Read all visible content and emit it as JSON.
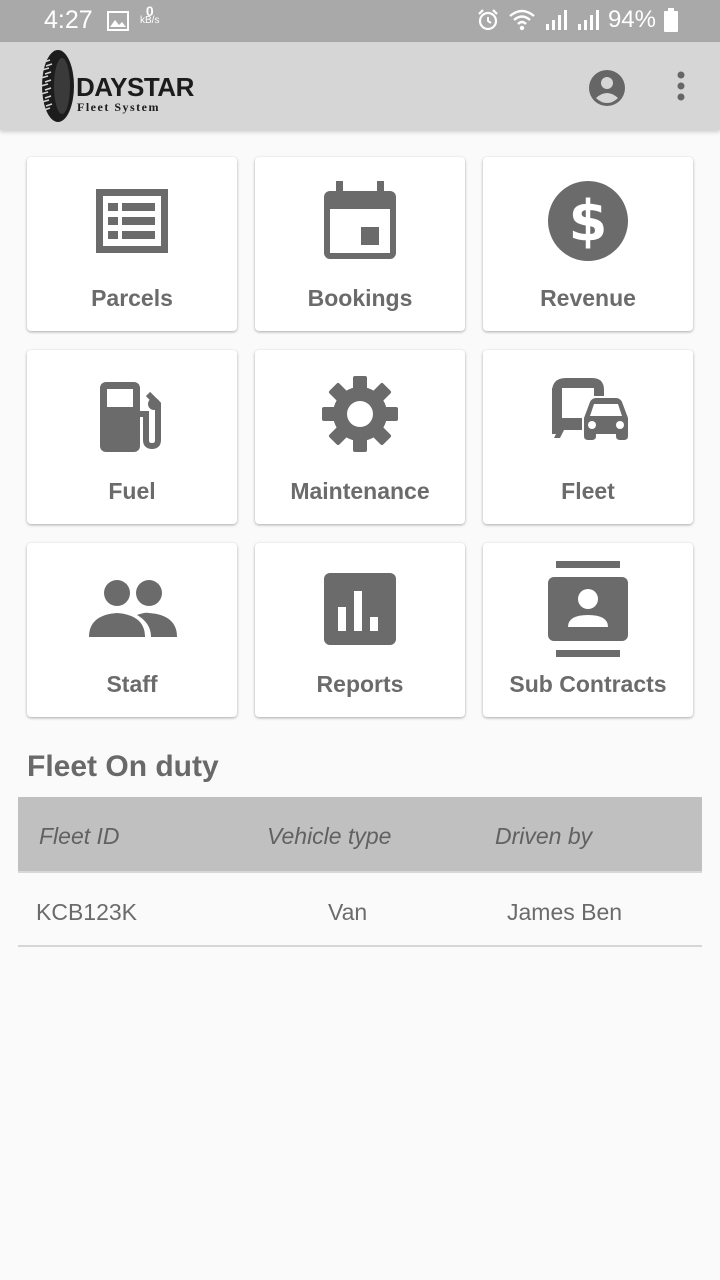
{
  "status_bar": {
    "time": "4:27",
    "data_rate_value": "0",
    "data_rate_unit": "kB/s",
    "battery": "94%"
  },
  "app_bar": {
    "logo_title": "DAYSTAR",
    "logo_subtitle": "Fleet System",
    "account_icon": "account-circle-icon",
    "menu_icon": "more-vert-icon"
  },
  "tiles": [
    {
      "label": "Parcels",
      "icon": "list-icon"
    },
    {
      "label": "Bookings",
      "icon": "calendar-icon"
    },
    {
      "label": "Revenue",
      "icon": "dollar-icon"
    },
    {
      "label": "Fuel",
      "icon": "fuel-pump-icon"
    },
    {
      "label": "Maintenance",
      "icon": "gear-icon"
    },
    {
      "label": "Fleet",
      "icon": "vehicles-icon"
    },
    {
      "label": "Staff",
      "icon": "people-icon"
    },
    {
      "label": "Reports",
      "icon": "bar-chart-icon"
    },
    {
      "label": "Sub Contracts",
      "icon": "contacts-icon"
    }
  ],
  "fleet_section": {
    "title": "Fleet On duty",
    "columns": [
      "Fleet ID",
      "Vehicle type",
      "Driven by"
    ],
    "rows": [
      {
        "fleet_id": "KCB123K",
        "vehicle_type": "Van",
        "driven_by": "James Ben"
      }
    ]
  },
  "colors": {
    "status_bar": "#a9a9a9",
    "app_bar": "#d6d6d6",
    "icon": "#6b6b6b",
    "table_header": "#c0c0c0"
  }
}
